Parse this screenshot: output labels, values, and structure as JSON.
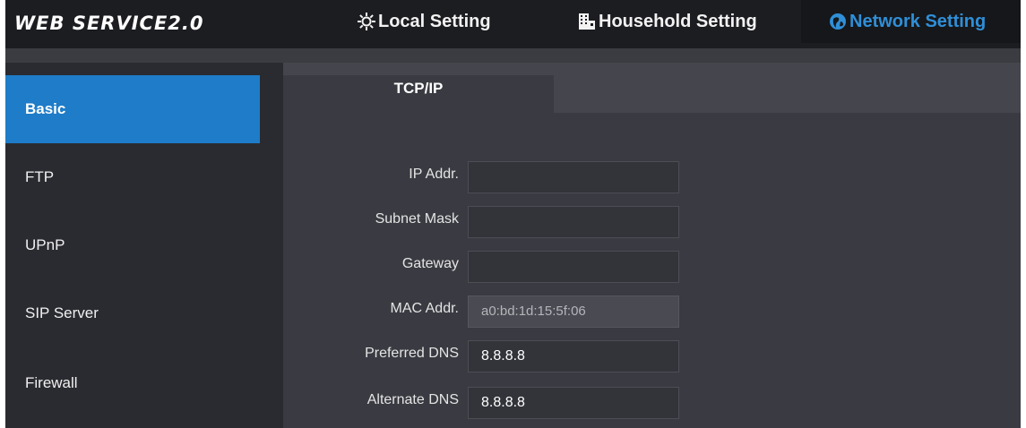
{
  "header": {
    "brand": "WEB SERVICE2.0",
    "nav": [
      {
        "label": "Local Setting",
        "icon": "gear-icon"
      },
      {
        "label": "Household Setting",
        "icon": "building-icon"
      },
      {
        "label": "Network Setting",
        "icon": "globe-icon",
        "active": true
      }
    ]
  },
  "sidebar": {
    "items": [
      {
        "label": "Basic",
        "active": true
      },
      {
        "label": "FTP"
      },
      {
        "label": "UPnP"
      },
      {
        "label": "SIP Server"
      },
      {
        "label": "Firewall"
      }
    ]
  },
  "main": {
    "tab": "TCP/IP",
    "fields": [
      {
        "label": "IP Addr.",
        "value": ""
      },
      {
        "label": "Subnet Mask",
        "value": ""
      },
      {
        "label": "Gateway",
        "value": ""
      },
      {
        "label": "MAC Addr.",
        "value": "a0:bd:1d:15:5f:06",
        "readonly": true
      },
      {
        "label": "Preferred DNS",
        "value": "8.8.8.8"
      },
      {
        "label": "Alternate DNS",
        "value": "8.8.8.8"
      }
    ]
  },
  "colors": {
    "accent": "#1e7cc8",
    "active_nav_text": "#2f8fd8",
    "header_bg": "#1c1d21",
    "panel_bg": "#3a3b42"
  }
}
